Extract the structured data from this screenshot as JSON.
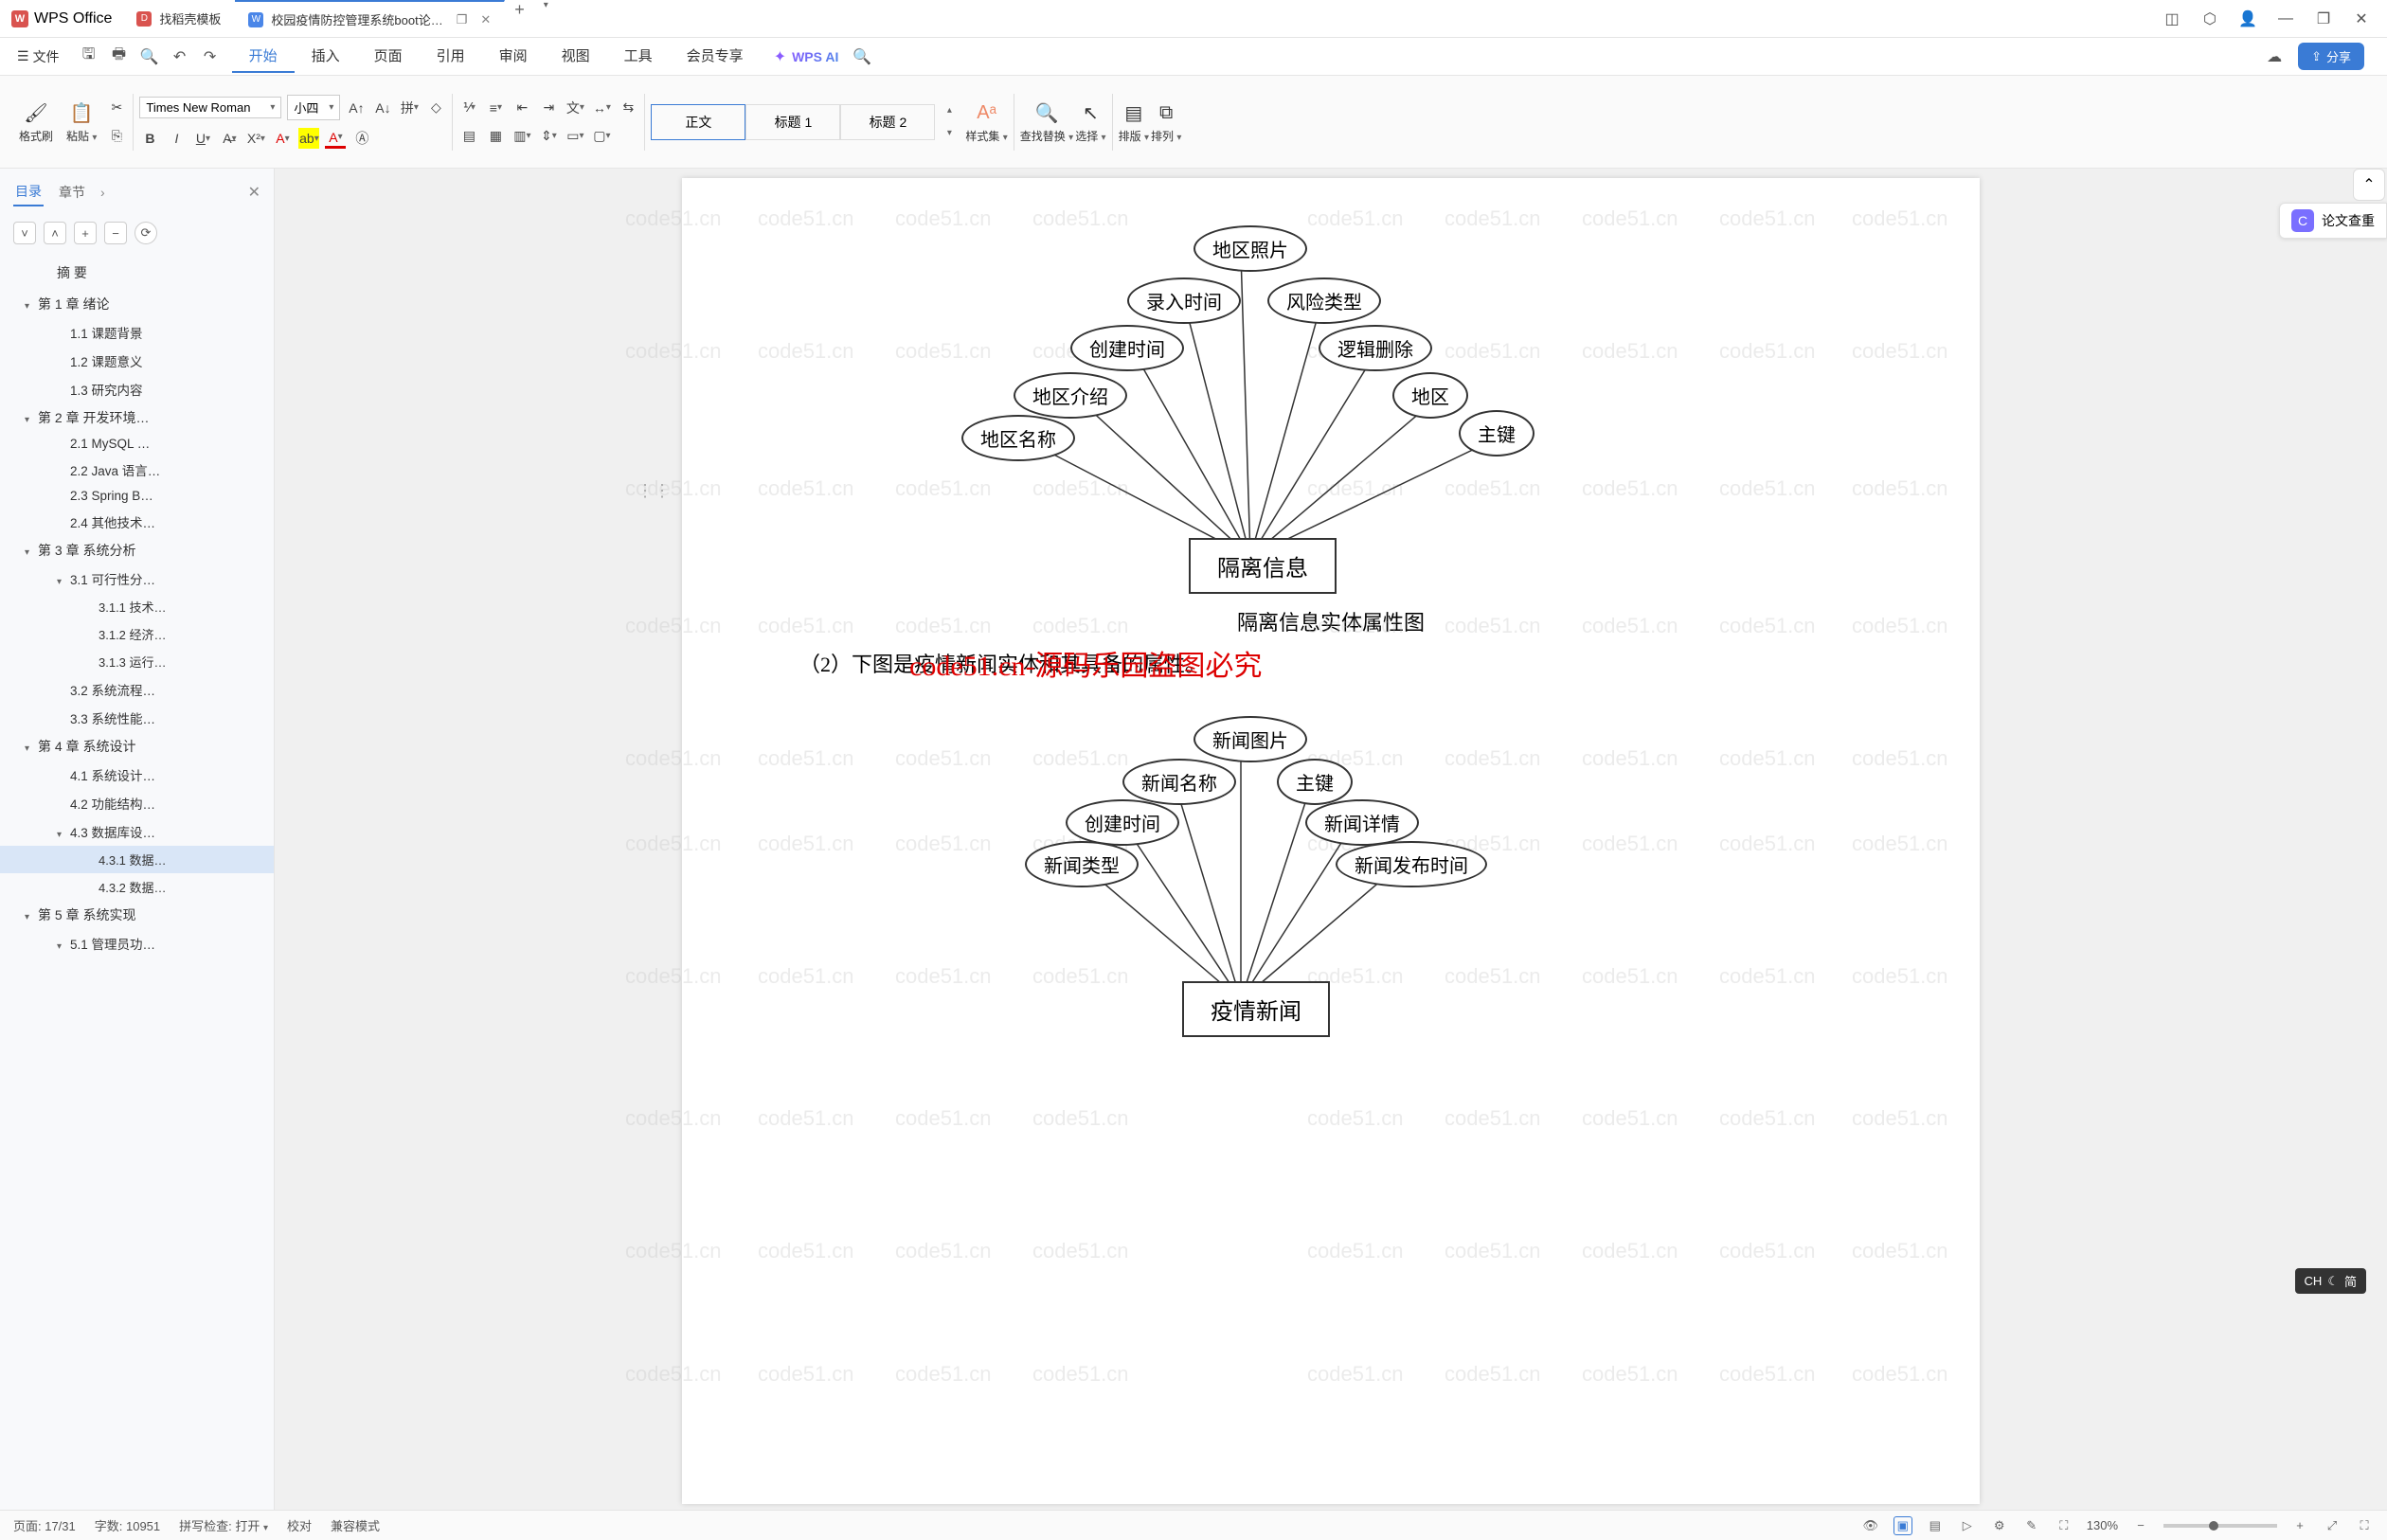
{
  "app": {
    "name": "WPS Office",
    "logo_letter": "W"
  },
  "tabs": [
    {
      "icon_color": "red",
      "icon_letter": "D",
      "label": "找稻壳模板",
      "active": false
    },
    {
      "icon_color": "blue",
      "icon_letter": "W",
      "label": "校园疫情防控管理系统boot论…",
      "active": true
    }
  ],
  "menu": {
    "file_label": "文件",
    "items": [
      "开始",
      "插入",
      "页面",
      "引用",
      "审阅",
      "视图",
      "工具",
      "会员专享"
    ],
    "active_index": 0,
    "ai_label": "WPS AI",
    "share_label": "分享"
  },
  "ribbon": {
    "format_brush": "格式刷",
    "paste": "粘贴",
    "font_name": "Times New Roman",
    "font_size": "小四",
    "styles": {
      "normal": "正文",
      "heading1": "标题 1",
      "heading2": "标题 2"
    },
    "styleset": "样式集",
    "find_replace": "查找替换",
    "select": "选择",
    "arrange": "排版",
    "order": "排列"
  },
  "sidebar": {
    "tab_toc": "目录",
    "tab_chapter": "章节",
    "summary": "摘  要",
    "outline": [
      {
        "level": 1,
        "text": "第 1 章  绪论",
        "exp": true
      },
      {
        "level": 2,
        "text": "1.1  课题背景"
      },
      {
        "level": 2,
        "text": "1.2  课题意义"
      },
      {
        "level": 2,
        "text": "1.3  研究内容"
      },
      {
        "level": 1,
        "text": "第 2 章  开发环境…",
        "exp": true
      },
      {
        "level": 2,
        "text": "2.1 MySQL …"
      },
      {
        "level": 2,
        "text": "2.2 Java 语言…"
      },
      {
        "level": 2,
        "text": "2.3 Spring B…"
      },
      {
        "level": 2,
        "text": "2.4  其他技术…"
      },
      {
        "level": 1,
        "text": "第 3 章  系统分析",
        "exp": true
      },
      {
        "level": 2,
        "text": "3.1  可行性分…",
        "exp": true
      },
      {
        "level": 3,
        "text": "3.1.1  技术…"
      },
      {
        "level": 3,
        "text": "3.1.2  经济…"
      },
      {
        "level": 3,
        "text": "3.1.3 运行…"
      },
      {
        "level": 2,
        "text": "3.2  系统流程…"
      },
      {
        "level": 2,
        "text": "3.3  系统性能…"
      },
      {
        "level": 1,
        "text": "第 4 章  系统设计",
        "exp": true
      },
      {
        "level": 2,
        "text": "4.1  系统设计…"
      },
      {
        "level": 2,
        "text": "4.2  功能结构…"
      },
      {
        "level": 2,
        "text": "4.3  数据库设…",
        "exp": true
      },
      {
        "level": 3,
        "text": "4.3.1  数据…",
        "selected": true
      },
      {
        "level": 3,
        "text": "4.3.2  数据…"
      },
      {
        "level": 1,
        "text": "第 5 章  系统实现",
        "exp": true
      },
      {
        "level": 2,
        "text": "5.1  管理员功…",
        "exp": true
      }
    ]
  },
  "document": {
    "watermark_text": "code51.cn",
    "watermark_red": "code51.cn-源码乐园盗图必究",
    "diagram1": {
      "center": "隔离信息",
      "attrs": [
        "地区照片",
        "录入时间",
        "风险类型",
        "创建时间",
        "逻辑删除",
        "地区介绍",
        "地区",
        "地区名称",
        "主键"
      ]
    },
    "caption1": "隔离信息实体属性图",
    "para2": "（2）下图是疫情新闻实体和其具备的属性。",
    "diagram2": {
      "center": "疫情新闻",
      "attrs": [
        "新闻图片",
        "新闻名称",
        "主键",
        "创建时间",
        "新闻详情",
        "新闻类型",
        "新闻发布时间"
      ]
    }
  },
  "right_panel": {
    "check_label": "论文查重"
  },
  "ime": {
    "label": "CH",
    "mode": "简"
  },
  "status": {
    "page": "页面: 17/31",
    "words": "字数: 10951",
    "spell": "拼写检查: 打开",
    "proof": "校对",
    "compat": "兼容模式",
    "zoom": "130%"
  }
}
